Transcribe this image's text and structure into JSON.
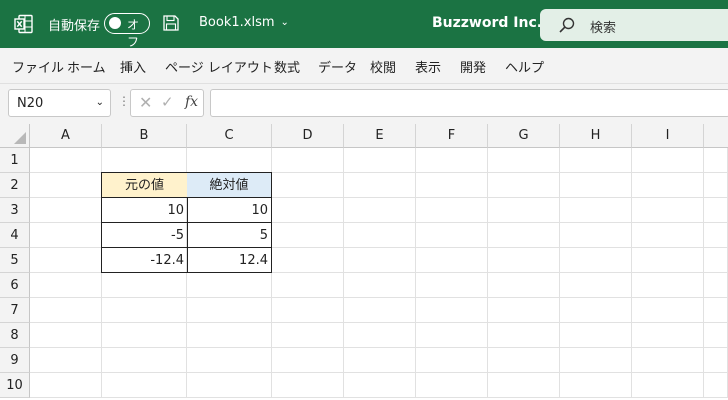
{
  "titlebar": {
    "autosave_label": "自動保存",
    "autosave_state": "オフ",
    "filename": "Book1.xlsm",
    "company": "Buzzword Inc.",
    "search_placeholder": "検索",
    "background_color": "#1b7343"
  },
  "menu": {
    "items": [
      "ファイル",
      "ホーム",
      "挿入",
      "ページ レイアウト",
      "数式",
      "データ",
      "校閲",
      "表示",
      "開発",
      "ヘルプ"
    ]
  },
  "formula_bar": {
    "name_box": "N20",
    "formula": "",
    "fx_label": "fx"
  },
  "sheet": {
    "columns": [
      "A",
      "B",
      "C",
      "D",
      "E",
      "F",
      "G",
      "H",
      "I"
    ],
    "rows": [
      "1",
      "2",
      "3",
      "4",
      "5",
      "6",
      "7",
      "8",
      "9",
      "10"
    ],
    "table": {
      "headers": [
        "元の値",
        "絶対値"
      ],
      "header_colors": [
        "#fff2cc",
        "#ddebf7"
      ],
      "rows": [
        [
          "10",
          "10"
        ],
        [
          "-5",
          "5"
        ],
        [
          "-12.4",
          "12.4"
        ]
      ]
    }
  }
}
